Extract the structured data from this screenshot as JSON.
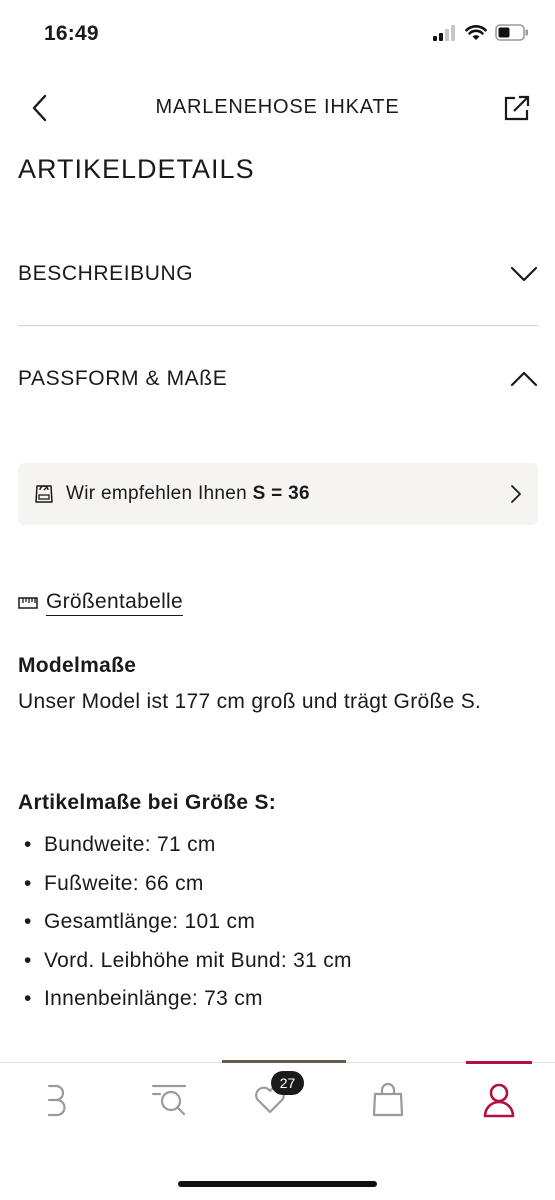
{
  "status_bar": {
    "time": "16:49",
    "icons": [
      "cellular-signal-icon",
      "wifi-icon",
      "battery-icon"
    ]
  },
  "header": {
    "title": "MARLENEHOSE IHKATE",
    "back_icon": "chevron-left-icon",
    "share_icon": "share-icon"
  },
  "page": {
    "section_title": "ARTIKELDETAILS"
  },
  "accordions": [
    {
      "label": "BESCHREIBUNG",
      "state": "collapsed",
      "icon": "chevron-down-icon"
    },
    {
      "label": "PASSFORM & MAßE",
      "state": "expanded",
      "icon": "chevron-up-icon"
    }
  ],
  "recommendation": {
    "prefix": "Wir empfehlen Ihnen",
    "size": "S = 36",
    "icon": "scale-icon",
    "arrow": "chevron-right-icon"
  },
  "size_table": {
    "label": "Größentabelle",
    "icon": "ruler-icon"
  },
  "model": {
    "heading": "Modelmaße",
    "text": "Unser Model ist 177 cm groß und trägt Größe S."
  },
  "measurements": {
    "heading": "Artikelmaße bei Größe S:",
    "items": [
      "Bundweite: 71 cm",
      "Fußweite: 66 cm",
      "Gesamtlänge: 101 cm",
      "Vord. Leibhöhe mit Bund: 31 cm",
      "Innenbeinlänge: 73 cm"
    ]
  },
  "tab_bar": {
    "tabs": [
      {
        "name": "home",
        "icon": "brand-b-icon"
      },
      {
        "name": "search",
        "icon": "search-icon"
      },
      {
        "name": "wishlist",
        "icon": "heart-icon",
        "badge": "27"
      },
      {
        "name": "bag",
        "icon": "shopping-bag-icon"
      },
      {
        "name": "account",
        "icon": "user-icon",
        "active": true
      }
    ],
    "accent_color": "#b3103e"
  }
}
